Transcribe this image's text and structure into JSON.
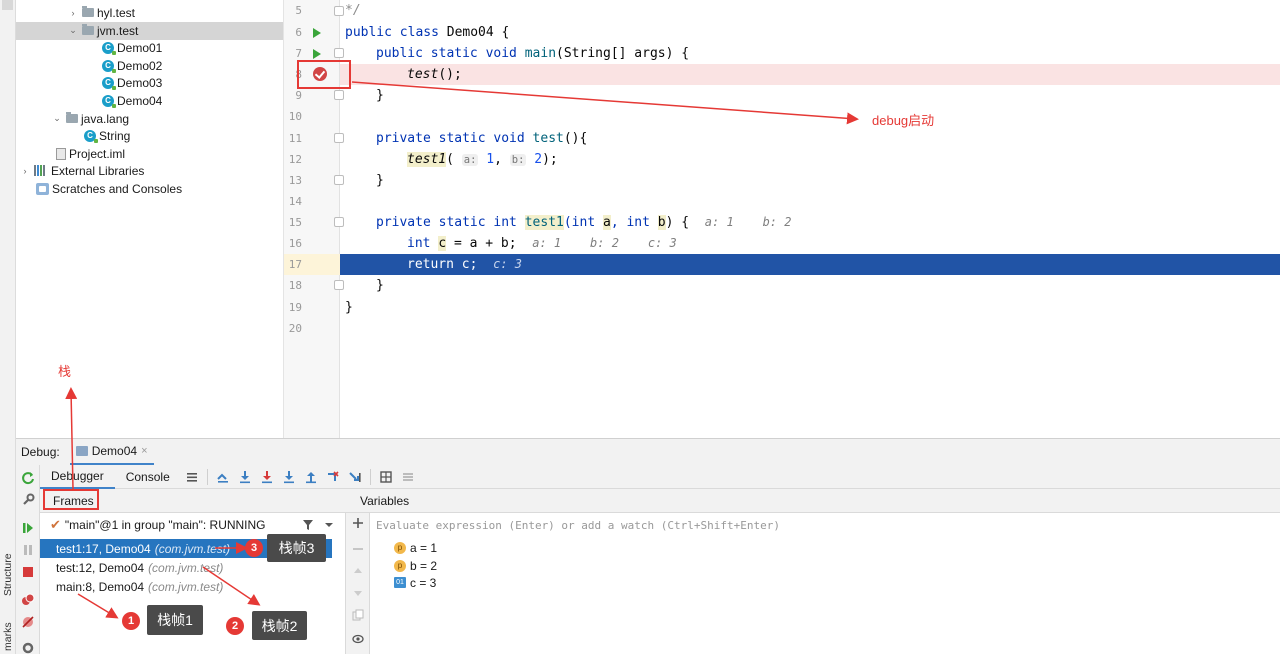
{
  "tree": {
    "items": [
      {
        "label": "hyl.test",
        "arrow": "›"
      },
      {
        "label": "jvm.test",
        "arrow": "⌄"
      },
      {
        "label": "Demo01",
        "icon": "C"
      },
      {
        "label": "Demo02",
        "icon": "C"
      },
      {
        "label": "Demo03",
        "icon": "C"
      },
      {
        "label": "Demo04",
        "icon": "C"
      },
      {
        "label": "java.lang",
        "arrow": "⌄"
      },
      {
        "label": "String",
        "icon": "C"
      },
      {
        "label": "Project.iml"
      },
      {
        "label": "External Libraries",
        "arrow": "›"
      },
      {
        "label": "Scratches and Consoles"
      }
    ]
  },
  "editor": {
    "line_numbers": [
      "5",
      "6",
      "7",
      "8",
      "9",
      "10",
      "11",
      "12",
      "13",
      "14",
      "15",
      "16",
      "17",
      "18",
      "19",
      "20"
    ],
    "lines": {
      "l5": "*/",
      "l6_kw": "public class",
      "l6_rest": " Demo04 {",
      "l7_kw": "public static void",
      "l7_fn": "main",
      "l7_rest": "(String[] args) {",
      "l8_call": "test",
      "l8_rest": "();",
      "l9": "}",
      "l11_kw": "private static void",
      "l11_fn": "test",
      "l11_rest": "(){",
      "l12_call": "test1",
      "l12_hint_a": "a:",
      "l12_val_a": "1",
      "l12_hint_b": "b:",
      "l12_val_b": "2",
      "l12_end": ");",
      "l13": "}",
      "l15_kw": "private static int",
      "l15_fn": "test1",
      "l15_args": "(int ",
      "l15_a": "a",
      "l15_mid": ", int ",
      "l15_b": "b",
      "l15_end": ") {",
      "l15_inline": "a: 1    b: 2",
      "l16_kw": "int",
      "l16_c": "c",
      "l16_rest": " = a + b;",
      "l16_inline": "a: 1    b: 2    c: 3",
      "l17_kw": "return",
      "l17_rest": " c;",
      "l17_inline": "c: 3",
      "l18": "}",
      "l19": "}"
    }
  },
  "annotations": {
    "debug_start": "debug启动",
    "stack": "栈",
    "frame1": "栈帧1",
    "frame2": "栈帧2",
    "frame3": "栈帧3",
    "badge1": "1",
    "badge2": "2",
    "badge3": "3"
  },
  "debug": {
    "title": "Debug:",
    "run_config": "Demo04",
    "close": "×",
    "tabs": [
      "Debugger",
      "Console"
    ],
    "frames_label": "Frames",
    "variables_label": "Variables",
    "thread": "\"main\"@1 in group \"main\": RUNNING",
    "frames": [
      {
        "method": "test1:17, Demo04",
        "pkg": "(com.jvm.test)"
      },
      {
        "method": "test:12, Demo04",
        "pkg": "(com.jvm.test)"
      },
      {
        "method": "main:8, Demo04",
        "pkg": "(com.jvm.test)"
      }
    ],
    "eval_placeholder": "Evaluate expression (Enter) or add a watch (Ctrl+Shift+Enter)",
    "variables": [
      {
        "icon": "p",
        "text": "a = 1"
      },
      {
        "icon": "p",
        "text": "b = 2"
      },
      {
        "icon": "01",
        "text": "c = 3"
      }
    ]
  },
  "sidebar": {
    "structure": "Structure",
    "bookmarks": "marks"
  },
  "colors": {
    "accent": "#2675bf",
    "execution_line": "#2154a6",
    "breakpoint_line": "#fae3e3",
    "annotation": "#e53935"
  }
}
